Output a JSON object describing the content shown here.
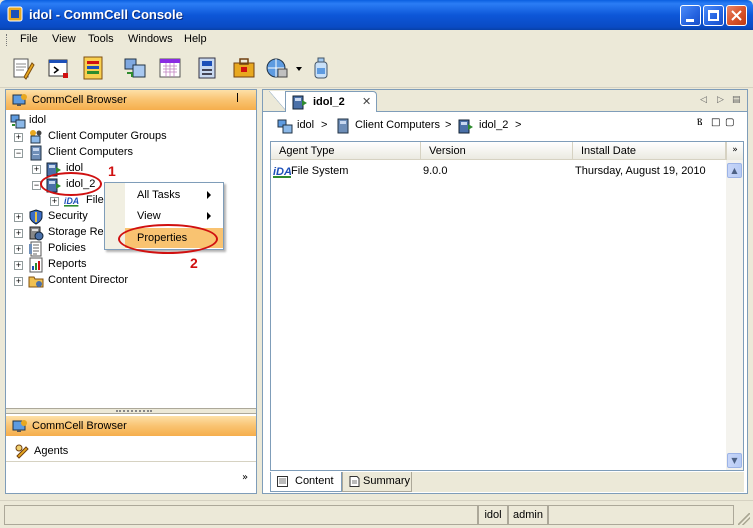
{
  "window": {
    "title": "idol - CommCell Console"
  },
  "menu": {
    "items": [
      "File",
      "View",
      "Tools",
      "Windows",
      "Help"
    ]
  },
  "left_pane": {
    "header": "CommCell Browser",
    "pin": "⌈",
    "tree": {
      "root": "idol",
      "client_computer_groups": "Client Computer Groups",
      "client_computers": "Client Computers",
      "client_idol": "idol",
      "client_idol_2": "idol_2",
      "file_system_partial": "File",
      "security": "Security",
      "storage_resources_partial": "Storage Res",
      "policies": "Policies",
      "reports": "Reports",
      "content_director": "Content Director"
    },
    "bottom_panel": {
      "header": "CommCell Browser",
      "agents": "Agents",
      "chevron": "»"
    }
  },
  "context_menu": {
    "items": [
      {
        "label": "All Tasks",
        "submenu": true
      },
      {
        "label": "View",
        "submenu": true
      },
      {
        "label": "Properties",
        "submenu": false
      }
    ]
  },
  "callouts": {
    "one": "1",
    "two": "2"
  },
  "right_pane": {
    "tab": {
      "label": "idol_2",
      "close": "✕"
    },
    "tab_nav": {
      "left": "◁",
      "right": "▷",
      "menu": "▤"
    },
    "breadcrumb": {
      "items": [
        "idol",
        "Client Computers",
        "idol_2"
      ],
      "sep": ">"
    },
    "breadcrumb_ctrls": {
      "pin": "Ⲃ",
      "restore": "□",
      "max": "▢"
    },
    "table": {
      "columns": [
        "Agent Type",
        "Version",
        "Install Date"
      ],
      "rows": [
        {
          "agent_type": "File System",
          "version": "9.0.0",
          "install_date": "Thursday, August 19, 2010"
        }
      ],
      "corner": "»"
    },
    "bottom_tabs": [
      "Content",
      "Summary"
    ]
  },
  "status_bar": {
    "host": "idol",
    "user": "admin"
  },
  "colors": {
    "title_blue": "#0A5FE0",
    "header_orange": "#F9C371",
    "annotation_red": "#D01010"
  }
}
